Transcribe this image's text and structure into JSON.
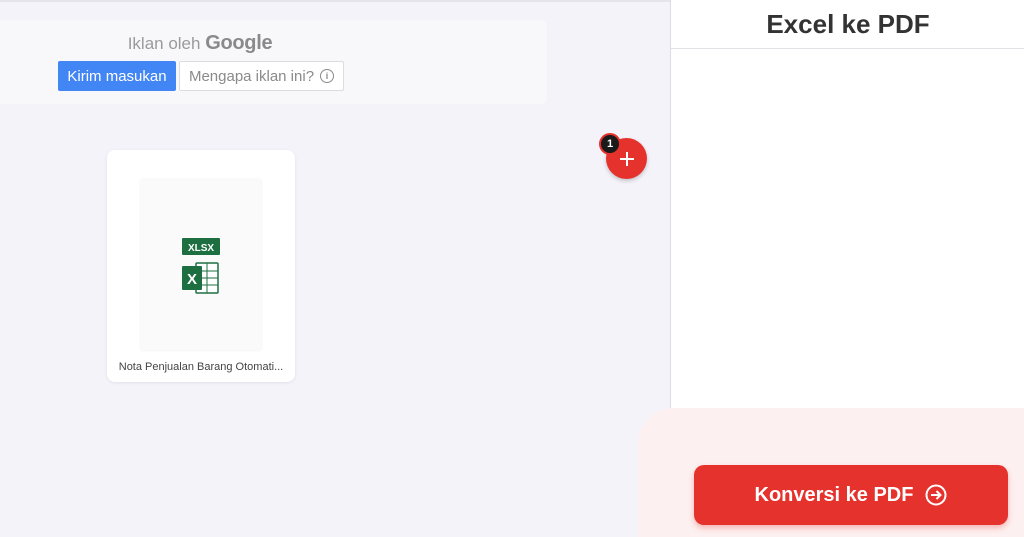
{
  "ad": {
    "by_prefix": "Iklan oleh",
    "by_brand": "Google",
    "feedback_button": "Kirim masukan",
    "why_button": "Mengapa iklan ini?"
  },
  "file": {
    "type_badge": "XLSX",
    "name": "Nota Penjualan Barang Otomati...",
    "icon": "excel-icon"
  },
  "add_button": {
    "badge_count": "1",
    "icon": "plus-icon"
  },
  "sidebar": {
    "title": "Excel ke PDF",
    "convert_button": "Konversi ke PDF",
    "convert_icon": "arrow-right-circle-icon"
  },
  "colors": {
    "primary_red": "#e5322d",
    "ad_blue": "#4285f4",
    "excel_green": "#1d6f42",
    "background": "#f4f3f9"
  }
}
